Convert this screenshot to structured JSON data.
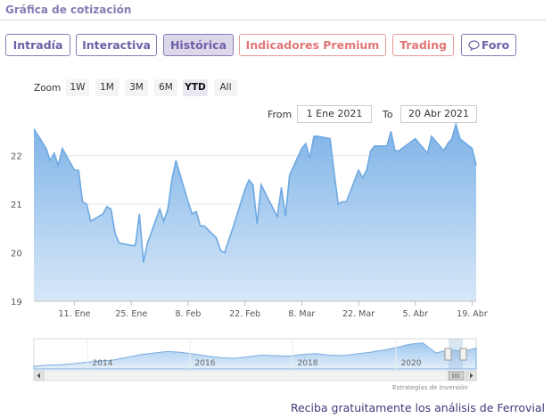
{
  "header": {
    "title": "Gráfica de cotización"
  },
  "tabs": [
    {
      "label": "Intradía",
      "style": "purple",
      "active": false
    },
    {
      "label": "Interactiva",
      "style": "purple",
      "active": false
    },
    {
      "label": "Histórica",
      "style": "purple",
      "active": true
    },
    {
      "label": "Indicadores Premium",
      "style": "red",
      "active": false
    },
    {
      "label": "Trading",
      "style": "red",
      "active": false
    },
    {
      "label": "Foro",
      "style": "purple",
      "active": false,
      "icon": "chat-bubble-icon"
    }
  ],
  "range_selector": {
    "zoom_label": "Zoom",
    "buttons": [
      "1W",
      "1M",
      "3M",
      "6M",
      "YTD",
      "All"
    ],
    "selected": "YTD",
    "from_label": "From",
    "from_value": "1 Ene 2021",
    "to_label": "To",
    "to_value": "20 Abr 2021"
  },
  "chart_data": {
    "type": "area",
    "x_tick_labels": [
      "11. Ene",
      "25. Ene",
      "8. Feb",
      "22. Feb",
      "8. Mar",
      "22. Mar",
      "5. Abr",
      "19. Abr"
    ],
    "ylim": [
      19,
      22.6
    ],
    "y_ticks": [
      19,
      20,
      21,
      22
    ],
    "grid": true,
    "series": [
      {
        "x": [
          "2021-01-01",
          "2021-01-04",
          "2021-01-05",
          "2021-01-06",
          "2021-01-07",
          "2021-01-08",
          "2021-01-11",
          "2021-01-12",
          "2021-01-13",
          "2021-01-14",
          "2021-01-15",
          "2021-01-18",
          "2021-01-19",
          "2021-01-20",
          "2021-01-21",
          "2021-01-22",
          "2021-01-25",
          "2021-01-26",
          "2021-01-27",
          "2021-01-28",
          "2021-01-29",
          "2021-02-01",
          "2021-02-02",
          "2021-02-03",
          "2021-02-04",
          "2021-02-05",
          "2021-02-08",
          "2021-02-09",
          "2021-02-10",
          "2021-02-11",
          "2021-02-12",
          "2021-02-15",
          "2021-02-16",
          "2021-02-17",
          "2021-02-18",
          "2021-02-19",
          "2021-02-22",
          "2021-02-23",
          "2021-02-24",
          "2021-02-25",
          "2021-02-26",
          "2021-03-01",
          "2021-03-02",
          "2021-03-03",
          "2021-03-04",
          "2021-03-05",
          "2021-03-08",
          "2021-03-09",
          "2021-03-10",
          "2021-03-11",
          "2021-03-12",
          "2021-03-15",
          "2021-03-16",
          "2021-03-17",
          "2021-03-18",
          "2021-03-19",
          "2021-03-22",
          "2021-03-23",
          "2021-03-24",
          "2021-03-25",
          "2021-03-26",
          "2021-03-29",
          "2021-03-30",
          "2021-03-31",
          "2021-04-01",
          "2021-04-05",
          "2021-04-06",
          "2021-04-07",
          "2021-04-08",
          "2021-04-09",
          "2021-04-12",
          "2021-04-13",
          "2021-04-14",
          "2021-04-15",
          "2021-04-16",
          "2021-04-19",
          "2021-04-20"
        ],
        "y": [
          22.55,
          22.15,
          21.9,
          22.05,
          21.8,
          22.15,
          21.7,
          21.7,
          21.05,
          21.0,
          20.65,
          20.8,
          20.95,
          20.9,
          20.4,
          20.2,
          20.15,
          20.15,
          20.8,
          19.8,
          20.2,
          20.9,
          20.65,
          20.9,
          21.5,
          21.9,
          21.05,
          20.8,
          20.85,
          20.55,
          20.55,
          20.3,
          20.05,
          20.0,
          20.25,
          20.5,
          21.3,
          21.5,
          21.4,
          20.6,
          21.4,
          20.9,
          20.75,
          21.35,
          20.75,
          21.6,
          22.15,
          22.25,
          21.95,
          22.4,
          22.4,
          22.35,
          21.65,
          21.0,
          21.05,
          21.05,
          21.7,
          21.55,
          21.7,
          22.1,
          22.2,
          22.2,
          22.5,
          22.1,
          22.1,
          22.35,
          22.25,
          22.15,
          22.05,
          22.4,
          22.1,
          22.25,
          22.35,
          22.65,
          22.35,
          22.15,
          21.8
        ]
      }
    ]
  },
  "navigator": {
    "year_labels": [
      "2014",
      "2016",
      "2018",
      "2020"
    ]
  },
  "credits": "Estrategias de Inversión",
  "footer": {
    "promo_link": "Reciba gratuitamente los análisis de Ferrovial"
  },
  "colors": {
    "accent_purple": "#8a7bb5",
    "accent_red": "#e07676",
    "series_line": "#6ea9e2",
    "series_fill": "#9ec6ee"
  }
}
